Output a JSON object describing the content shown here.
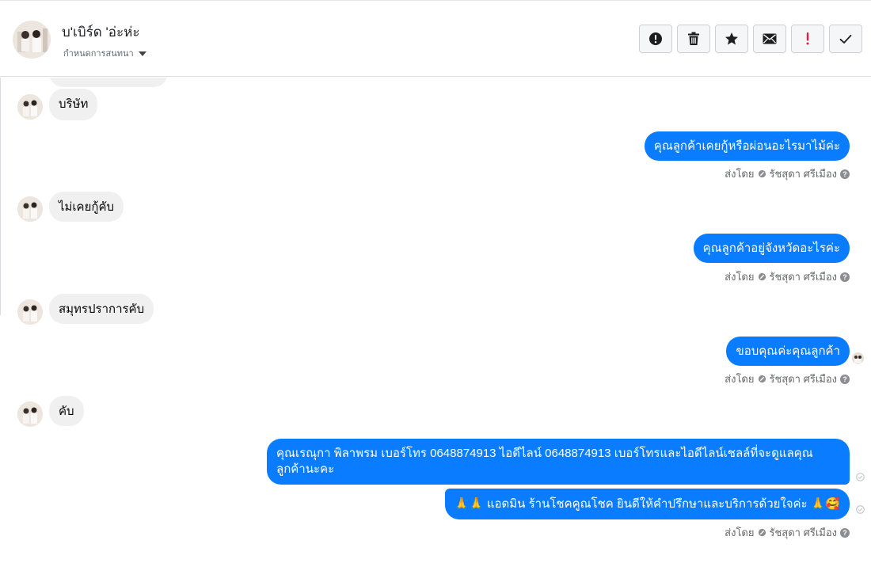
{
  "header": {
    "contact_name": "บ'เบิร์ด 'อ่ะห่ะ",
    "conversation_settings": "กำหนดการสนทนา",
    "actions": [
      {
        "name": "report-button",
        "icon": "exclamation-circle-icon"
      },
      {
        "name": "delete-button",
        "icon": "trash-icon"
      },
      {
        "name": "star-button",
        "icon": "star-icon"
      },
      {
        "name": "mark-unread-button",
        "icon": "envelope-icon"
      },
      {
        "name": "flag-spam-button",
        "icon": "exclamation-icon"
      },
      {
        "name": "mark-done-button",
        "icon": "check-icon"
      }
    ]
  },
  "colors": {
    "outgoing_bubble": "#0a7cff",
    "incoming_bubble": "#f0f0f0",
    "spam_icon": "#e41e3f"
  },
  "messages": {
    "m1": "บริษัท",
    "m2": "คุณลูกค้าเคยกู้หรือผ่อนอะไรมาไม้ค่ะ",
    "m3": "ไม่เคยกู้คับ",
    "m4": "คุณลูกค้าอยู่จังหวัดอะไรค่ะ",
    "m5": "สมุทรปราการคับ",
    "m6": "ขอบคุณค่ะคุณลูกค้า",
    "m7": "คับ",
    "m8": "คุณเรณุกา พิลาพรม        เบอร์โทร 0648874913  ไอดีไลน์ 0648874913  เบอร์โทรและไอดีไลน์เชลล์ที่จะดูแลคุณลูกค้านะคะ",
    "m9_prefix": "🙏🙏",
    "m9_text": "แอดมิน ร้านโชคคูณโชค ยินดีให้คำปรึกษาและบริการด้วยใจค่ะ",
    "m9_suffix": "🙏🥰"
  },
  "sent_by": {
    "label": "ส่งโดย",
    "agent": "รัชสุดา ศรีเมือง"
  }
}
